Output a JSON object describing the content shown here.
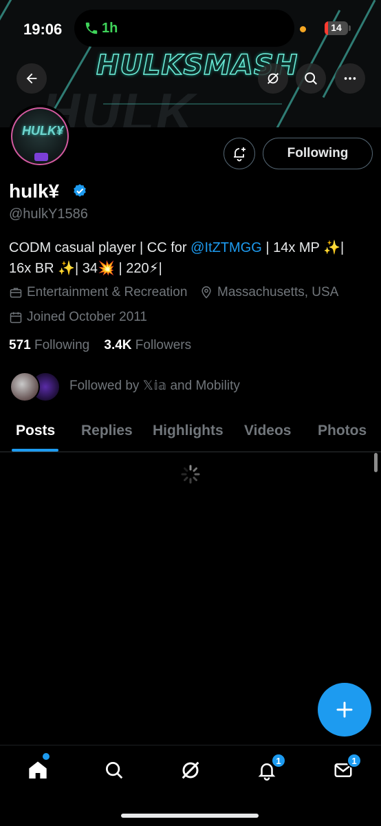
{
  "status_bar": {
    "time": "19:06",
    "call_duration": "1h",
    "battery_level": "14"
  },
  "banner": {
    "title": "HULKSMASH"
  },
  "profile": {
    "avatar_text": "HULK¥",
    "display_name": "hulk¥",
    "handle": "@hulkY1586",
    "bio_prefix": "CODM casual player | CC for ",
    "bio_mention": "@ItZTMGG",
    "bio_suffix": " | 14x MP ✨|",
    "bio_line2": "16x BR ✨| 34💥 | 220⚡|",
    "category": "Entertainment & Recreation",
    "location": "Massachusetts, USA",
    "joined": "Joined October 2011",
    "following_count": "571",
    "following_label": "Following",
    "followers_count": "3.4K",
    "followers_label": "Followers",
    "followed_by": "Followed by 𝕏𝕚𝕒 and Mobility"
  },
  "actions": {
    "following_button": "Following"
  },
  "tabs": [
    {
      "label": "Posts",
      "active": true
    },
    {
      "label": "Replies",
      "active": false
    },
    {
      "label": "Highlights",
      "active": false
    },
    {
      "label": "Videos",
      "active": false
    },
    {
      "label": "Photos",
      "active": false
    }
  ],
  "bottom_nav": {
    "notifications_badge": "1",
    "messages_badge": "1"
  },
  "colors": {
    "accent": "#1d9bf0",
    "muted": "#71767b",
    "banner_glow": "#6ff0dc"
  },
  "icons": [
    "back-arrow-icon",
    "grok-icon",
    "search-icon",
    "more-icon",
    "bell-plus-icon",
    "verified-badge-icon",
    "briefcase-icon",
    "location-pin-icon",
    "calendar-icon",
    "spinner-icon",
    "plus-icon",
    "home-icon",
    "messages-icon"
  ]
}
